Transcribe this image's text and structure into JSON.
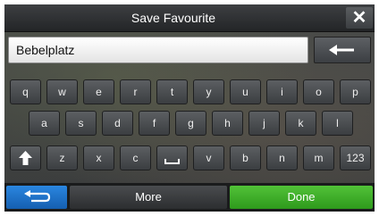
{
  "window": {
    "title": "Save Favourite"
  },
  "input": {
    "value": "Bebelplatz"
  },
  "keyboard": {
    "row1": [
      "q",
      "w",
      "e",
      "r",
      "t",
      "y",
      "u",
      "i",
      "o",
      "p"
    ],
    "row2": [
      "a",
      "s",
      "d",
      "f",
      "g",
      "h",
      "j",
      "k",
      "l"
    ],
    "row3": [
      "z",
      "x",
      "c",
      "v",
      "b",
      "n",
      "m"
    ],
    "numbers_label": "123"
  },
  "buttons": {
    "more": "More",
    "done": "Done"
  },
  "icons": {
    "close": "close-icon",
    "backspace": "backspace-arrow-icon",
    "shift": "shift-arrow-up-icon",
    "space": "space-bar-icon",
    "back": "back-arrow-icon"
  },
  "colors": {
    "done": "#3aa628",
    "back": "#1f73c9"
  }
}
